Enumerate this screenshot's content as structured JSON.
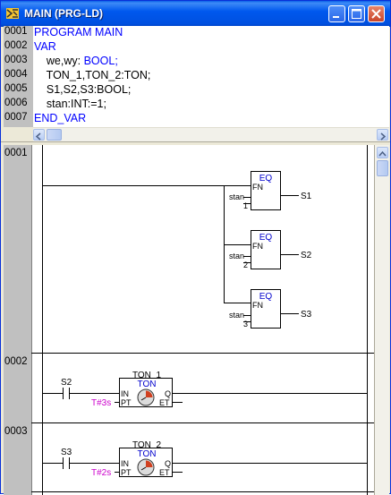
{
  "window": {
    "title": "MAIN (PRG-LD)",
    "icon": "ld-editor-icon"
  },
  "declaration": {
    "line_numbers": [
      "0001",
      "0002",
      "0003",
      "0004",
      "0005",
      "0006",
      "0007"
    ],
    "lines": [
      {
        "parts": [
          {
            "text": "PROGRAM MAIN",
            "kw": true
          }
        ]
      },
      {
        "parts": [
          {
            "text": "VAR",
            "kw": true
          }
        ]
      },
      {
        "parts": [
          {
            "text": "    we,wy: ",
            "kw": false
          },
          {
            "text": "BOOL;",
            "kw": true
          }
        ]
      },
      {
        "parts": [
          {
            "text": "    TON_1,TON_2:TON;",
            "kw": false
          }
        ]
      },
      {
        "parts": [
          {
            "text": "    S1,S2,S3:BOOL;",
            "kw": false
          }
        ]
      },
      {
        "parts": [
          {
            "text": "    stan:INT:=1;",
            "kw": false
          }
        ]
      },
      {
        "parts": [
          {
            "text": "END_VAR",
            "kw": true
          }
        ]
      }
    ]
  },
  "networks": [
    {
      "number": "0001",
      "blocks": [
        {
          "type": "EQ",
          "fn": "FN",
          "in_var": "stan",
          "const": "1",
          "out": "S1"
        },
        {
          "type": "EQ",
          "fn": "FN",
          "in_var": "stan",
          "const": "2",
          "out": "S2"
        },
        {
          "type": "EQ",
          "fn": "FN",
          "in_var": "stan",
          "const": "3",
          "out": "S3"
        }
      ]
    },
    {
      "number": "0002",
      "contact": "S2",
      "fb": {
        "instance": "TON_1",
        "type": "TON",
        "in": "IN",
        "pt": "PT",
        "q": "Q",
        "et": "ET",
        "pt_value": "T#3s"
      }
    },
    {
      "number": "0003",
      "contact": "S3",
      "fb": {
        "instance": "TON_2",
        "type": "TON",
        "in": "IN",
        "pt": "PT",
        "q": "Q",
        "et": "ET",
        "pt_value": "T#2s"
      }
    }
  ],
  "colors": {
    "keyword": "#0000ff",
    "constant": "#cc00cc",
    "titlebar": "#0054e3"
  }
}
